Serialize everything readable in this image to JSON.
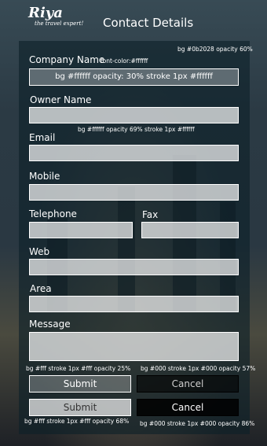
{
  "header": {
    "logo": "Riya",
    "logo_tagline": "the travel expert!",
    "title": "Contact Details"
  },
  "notes": {
    "panel_bg": "bg #0b2028 opacity 60%",
    "label_color": "font-color:#ffffff",
    "field_style": "bg #ffffff opacity 69% stroke 1px #ffffff",
    "submit_style_1": "bg #fff stroke 1px #fff opacity 25%",
    "cancel_style_1": "bg #000 stroke 1px #000 opacity 57%",
    "submit_style_2": "bg #fff stroke 1px #fff opacity 68%",
    "cancel_style_2": "bg #000 stroke 1px #000 opacity 86%"
  },
  "form": {
    "company_name": {
      "label": "Company Name",
      "value": "bg #ffffff opacity: 30% stroke 1px #ffffff"
    },
    "owner_name": {
      "label": "Owner Name",
      "value": ""
    },
    "email": {
      "label": "Email",
      "value": ""
    },
    "mobile": {
      "label": "Mobile",
      "value": ""
    },
    "telephone": {
      "label": "Telephone",
      "value": ""
    },
    "fax": {
      "label": "Fax",
      "value": ""
    },
    "web": {
      "label": "Web",
      "value": ""
    },
    "area": {
      "label": "Area",
      "value": ""
    },
    "message": {
      "label": "Message",
      "value": ""
    }
  },
  "buttons": {
    "submit": "Submit",
    "cancel": "Cancel"
  },
  "colors": {
    "panel_bg": "#0b2028",
    "text": "#ffffff"
  }
}
